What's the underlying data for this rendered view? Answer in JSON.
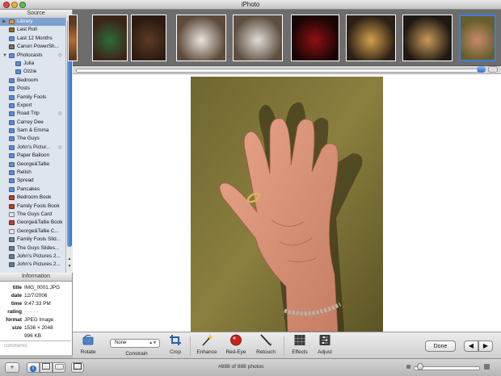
{
  "window": {
    "title": "iPhoto"
  },
  "source": {
    "header": "Source",
    "items": [
      {
        "label": "Library",
        "icon": "library-icon",
        "selected": true,
        "disclosure": "▶"
      },
      {
        "label": "Last Roll",
        "icon": "last-roll-icon"
      },
      {
        "label": "Last 12 Months",
        "icon": "calendar-icon"
      },
      {
        "label": "Canon PowerSh...",
        "icon": "camera-icon"
      },
      {
        "label": "Photocasts",
        "icon": "photocast-folder-icon",
        "disclosure": "▼",
        "shared": true
      },
      {
        "label": "Julia",
        "icon": "photocast-icon",
        "sub": true
      },
      {
        "label": "Ozzie",
        "icon": "photocast-icon",
        "sub": true
      },
      {
        "label": "Bedroom",
        "icon": "album-icon"
      },
      {
        "label": "Posts",
        "icon": "album-icon"
      },
      {
        "label": "Family Fools",
        "icon": "album-icon"
      },
      {
        "label": "Export",
        "icon": "album-icon"
      },
      {
        "label": "Road Trip",
        "icon": "album-icon",
        "shared": true
      },
      {
        "label": "Carrey Dee",
        "icon": "album-icon"
      },
      {
        "label": "Sam & Emma",
        "icon": "album-icon"
      },
      {
        "label": "The Guys",
        "icon": "album-icon"
      },
      {
        "label": "John's Pictur...",
        "icon": "album-icon",
        "shared": true
      },
      {
        "label": "Paper Balloon",
        "icon": "album-icon"
      },
      {
        "label": "George&Tallie",
        "icon": "album-icon"
      },
      {
        "label": "Relish",
        "icon": "album-icon"
      },
      {
        "label": "Spread",
        "icon": "album-icon"
      },
      {
        "label": "Pancakes",
        "icon": "album-icon"
      },
      {
        "label": "Bedroom Book",
        "icon": "book-icon"
      },
      {
        "label": "Family Fools Book",
        "icon": "book-icon"
      },
      {
        "label": "The Guys Card",
        "icon": "card-icon"
      },
      {
        "label": "George&Tallie Book",
        "icon": "book-icon"
      },
      {
        "label": "George&Tallie C...",
        "icon": "calendar-project-icon"
      },
      {
        "label": "Family Fools Slid...",
        "icon": "slideshow-icon"
      },
      {
        "label": "The Guys Slides...",
        "icon": "slideshow-icon"
      },
      {
        "label": "John's Pictures 2...",
        "icon": "slideshow-icon"
      },
      {
        "label": "John's Pictures 2...",
        "icon": "slideshow-icon"
      }
    ]
  },
  "information": {
    "header": "Information",
    "rows": [
      {
        "key": "title",
        "value": "IMG_0001.JPG"
      },
      {
        "key": "date",
        "value": "12/7/2006"
      },
      {
        "key": "time",
        "value": "9:47:33 PM"
      },
      {
        "key": "rating",
        "value": "· · · · ·"
      },
      {
        "key": "format",
        "value": "JPEG Image"
      },
      {
        "key": "size",
        "value": "1536 × 2048"
      },
      {
        "key": "",
        "value": "996 KB"
      }
    ],
    "comments_placeholder": "comments"
  },
  "filmstrip": {
    "thumbs": [
      {
        "name": "thumb-partial",
        "colors": [
          "#5b3b22",
          "#b66e34"
        ]
      },
      {
        "name": "thumb-christmas-tree",
        "colors": [
          "#3c2518",
          "#2f6a3a"
        ]
      },
      {
        "name": "thumb-christmas-tree-2",
        "colors": [
          "#2c1b12",
          "#5b3b24"
        ]
      },
      {
        "name": "thumb-pipe-fitting",
        "colors": [
          "#5e4a3a",
          "#e8e4e0"
        ]
      },
      {
        "name": "thumb-pipe-fitting-2",
        "colors": [
          "#5e4f40",
          "#e0ddd7"
        ]
      },
      {
        "name": "thumb-red-light",
        "colors": [
          "#1a0505",
          "#8e1010"
        ]
      },
      {
        "name": "thumb-speakers",
        "colors": [
          "#2a2016",
          "#d4a04c"
        ]
      },
      {
        "name": "thumb-bulb",
        "colors": [
          "#1e1812",
          "#c99a58"
        ]
      },
      {
        "name": "thumb-hand",
        "colors": [
          "#665f2c",
          "#c68a6a"
        ]
      }
    ],
    "selected_index": 8
  },
  "toolbar": {
    "rotate": "Rotate",
    "constrain": "Constrain",
    "constrain_value": "None",
    "crop": "Crop",
    "enhance": "Enhance",
    "redeye": "Red-Eye",
    "retouch": "Retouch",
    "effects": "Effects",
    "adjust": "Adjust",
    "done": "Done"
  },
  "status": {
    "count": "#888 of 888 photos",
    "zoom_fraction": 0.05
  },
  "colors": {
    "accent": "#3f7ede",
    "selection": "#7fa1d1"
  }
}
